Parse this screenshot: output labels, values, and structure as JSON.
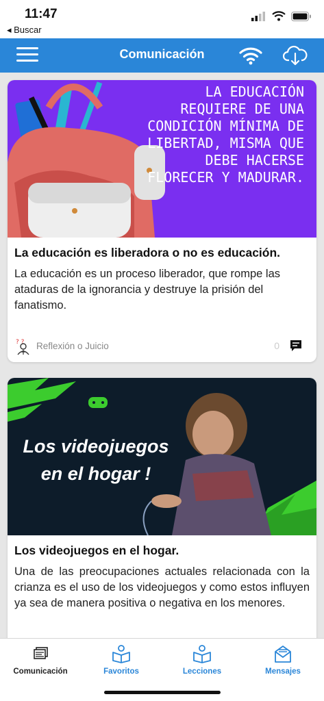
{
  "status": {
    "time": "11:47",
    "back_app": "◂ Buscar"
  },
  "nav": {
    "title": "Comunicación",
    "menu_icon": "hamburger-icon",
    "wifi_icon": "wifi-icon",
    "cloud_icon": "cloud-download-icon"
  },
  "cards": [
    {
      "image_text": "LA EDUCACIÓN REQUIERE DE UNA CONDICIÓN MÍNIMA DE LIBERTAD, MISMA QUE DEBE HACERSE FLORECER Y MADURAR.",
      "title": "La educación es liberadora o no es educación.",
      "description": "La educación es un proceso liberador, que rompe las ataduras de la ignorancia y destruye la prisión del fanatismo.",
      "author": "Reflexión o Juicio",
      "comments": "0"
    },
    {
      "image_text": "Los videojuegos en el hogar !",
      "title": "Los videojuegos en el hogar.",
      "description": "Una de las preocupaciones actuales relacionada con la crianza es el uso de los videojuegos y como estos influyen ya sea de manera positiva o negativa en los menores."
    }
  ],
  "tabs": [
    {
      "label": "Comunicación",
      "icon": "stack-icon",
      "active": true
    },
    {
      "label": "Favoritos",
      "icon": "reader-icon",
      "active": false
    },
    {
      "label": "Lecciones",
      "icon": "reader-icon",
      "active": false
    },
    {
      "label": "Mensajes",
      "icon": "mail-icon",
      "active": false
    }
  ],
  "colors": {
    "primary": "#2a86d8",
    "card1_bg": "#7a2ff0",
    "card2_bg": "#0d1c2a"
  }
}
